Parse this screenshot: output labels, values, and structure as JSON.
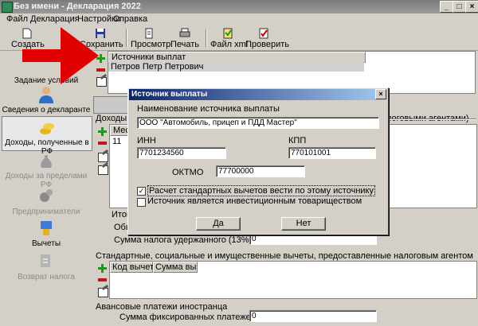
{
  "window": {
    "title": "Без имени - Декларация 2022"
  },
  "menu": [
    "Файл",
    "Декларация",
    "Настройки",
    "Справка"
  ],
  "toolbar": {
    "create": "Создать",
    "save": "Сохранить",
    "preview": "Просмотр",
    "print": "Печать",
    "xml": "Файл xml",
    "check": "Проверить"
  },
  "nav": {
    "items": [
      {
        "label": "Задание условий"
      },
      {
        "label": "Сведения о декларанте"
      },
      {
        "label": "Доходы, полученные в РФ"
      },
      {
        "label": "Доходы за пределами РФ"
      },
      {
        "label": "Предприниматели"
      },
      {
        "label": "Вычеты"
      },
      {
        "label": "Возврат налога"
      }
    ]
  },
  "sources": {
    "header": "Источники выплат",
    "rows": [
      "Петров Петр Петрович"
    ]
  },
  "income": {
    "group": "Доходы, об",
    "group_tail": "логовыми агентами)",
    "col_month": "Месяц",
    "month_value": "11"
  },
  "totals": {
    "group": "Итог",
    "total_label": "Общ",
    "tax_withheld_label": "Сумма налога удержанного (13%)",
    "tax_withheld_value": "0"
  },
  "deductions": {
    "group": "Стандартные, социальные и имущественные вычеты, предоставленные налоговым агентом",
    "col_code": "Код вычета",
    "col_sum": "Сумма выч..."
  },
  "advance": {
    "group": "Авансовые платежи иностранца",
    "fixed_label": "Сумма фиксированных платежей",
    "fixed_value": "0"
  },
  "dialog": {
    "title": "Источник выплаты",
    "name_label": "Наименование источника выплаты",
    "name_value": "ООО \"Автомобиль, прицеп и ПДД Мастер\"",
    "inn_label": "ИНН",
    "inn_value": "7701234560",
    "kpp_label": "КПП",
    "kpp_value": "770101001",
    "oktmo_label": "ОКТМО",
    "oktmo_value": "77700000",
    "chk_standard": "Расчет стандартных вычетов вести по этому источнику",
    "chk_standard_checked": true,
    "chk_invest": "Источник является инвестиционным товариществом",
    "chk_invest_checked": false,
    "yes": "Да",
    "no": "Нет"
  },
  "colors": {
    "arrow": "#e00000",
    "dialog_title": "#0a246a"
  }
}
